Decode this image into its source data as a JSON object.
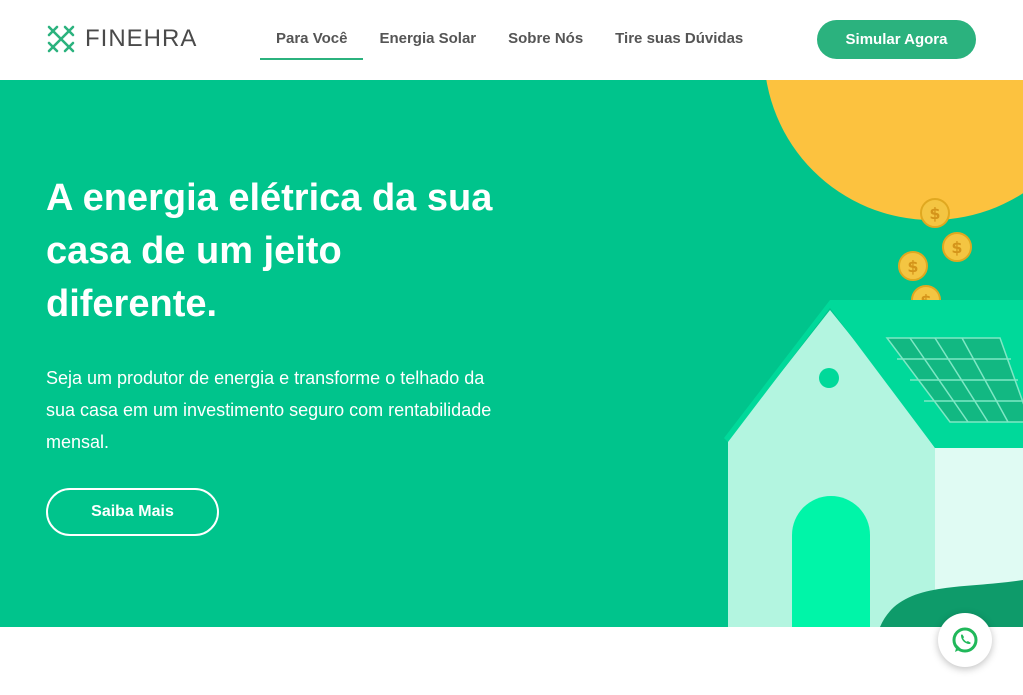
{
  "brand": {
    "name": "FINEHRA",
    "logo_icon": "finehra-logo-icon"
  },
  "nav": {
    "items": [
      {
        "label": "Para Você",
        "active": true
      },
      {
        "label": "Energia Solar",
        "active": false
      },
      {
        "label": "Sobre Nós",
        "active": false
      },
      {
        "label": "Tire suas Dúvidas",
        "active": false
      }
    ],
    "cta_label": "Simular Agora"
  },
  "hero": {
    "title": "A energia elétrica da sua casa de um jeito diferente.",
    "subtitle": "Seja um produtor de energia e transforme o telhado da sua casa em um investimento seguro com rentabilidade mensal.",
    "button_label": "Saiba Mais"
  },
  "floating": {
    "whatsapp_icon": "whatsapp-icon"
  },
  "colors": {
    "accent": "#2bb27e",
    "hero_bg": "#00c48c",
    "sun": "#fcc23f",
    "coin": "#f4c542",
    "house_wall": "#b3f5e0",
    "roof": "#00d99a",
    "door": "#00f5a8",
    "panel": "#12b882",
    "text_dark": "#555555"
  }
}
